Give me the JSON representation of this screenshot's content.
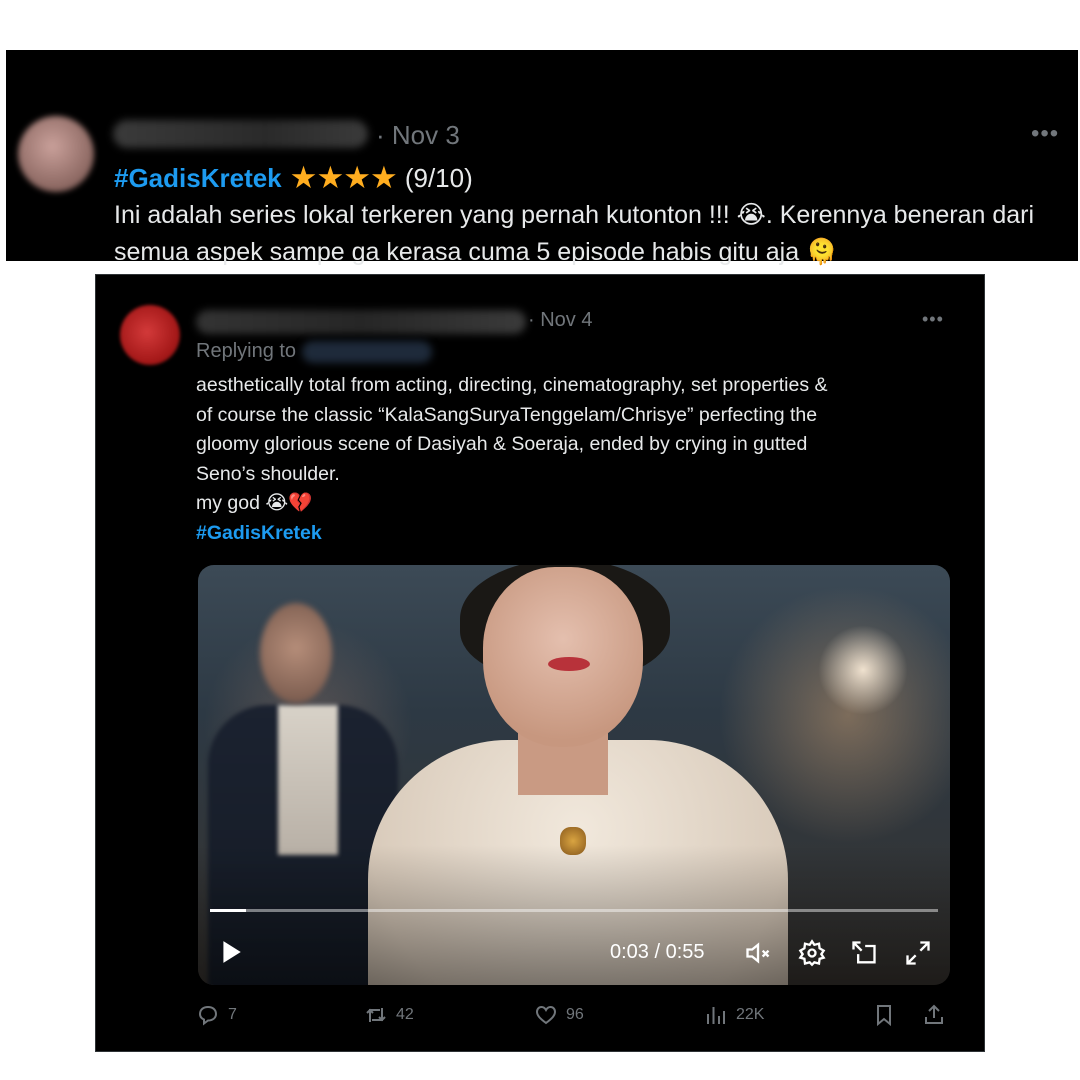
{
  "tweet1": {
    "date": "· Nov 3",
    "more_label": "•••",
    "hashtag": "#GadisKretek",
    "stars": "★★★★",
    "rating": "(9/10)",
    "body": "Ini adalah series lokal terkeren yang pernah kutonton !!! 😭. Kerennya beneran dari semua aspek sampe ga kerasa cuma 5 episode habis gitu aja 🫠"
  },
  "tweet2": {
    "date": "· Nov 4",
    "more_label": "•••",
    "replying_to": "Replying to",
    "body_lines": [
      "aesthetically total from acting, directing, cinematography, set properties &",
      "of course the classic “KalaSangSuryaTenggelam/Chrisye” perfecting the",
      "gloomy glorious scene of Dasiyah & Soeraja, ended by crying in gutted",
      "Seno’s shoulder.",
      "my god 😭💔"
    ],
    "hashtag": "#GadisKretek",
    "video": {
      "time": "0:03 / 0:55",
      "progress": 0.05
    },
    "actions": {
      "replies": "7",
      "reposts": "42",
      "likes": "96",
      "views": "22K"
    }
  },
  "colors": {
    "background": "#000000",
    "text": "#e7e9ea",
    "muted": "#71767b",
    "link": "#1d9bf0",
    "star": "#ffad1f"
  },
  "icons": [
    "more-icon",
    "play-icon",
    "mute-icon",
    "settings-icon",
    "pip-icon",
    "fullscreen-icon",
    "reply-icon",
    "repost-icon",
    "like-icon",
    "views-icon",
    "bookmark-icon",
    "share-icon"
  ]
}
